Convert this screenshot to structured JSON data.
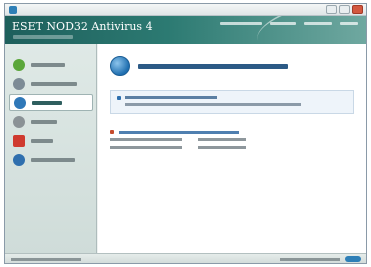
{
  "window": {
    "title": "",
    "app_name": "ESET NOD32 Antivirus 4",
    "tagline": ""
  },
  "colors": {
    "brand": "#2c7a72",
    "sidebar": "#dfe9e6",
    "accent_blue": "#1f6fb0",
    "warning": "#c64b2c"
  },
  "header_menu": [
    {
      "label": ""
    },
    {
      "label": ""
    },
    {
      "label": ""
    },
    {
      "label": ""
    }
  ],
  "sidebar": {
    "items": [
      {
        "label": "",
        "icon": "shield-check-icon",
        "color": "#5aa63a"
      },
      {
        "label": "",
        "icon": "magnifier-icon",
        "color": "#7d8b96"
      },
      {
        "label": "",
        "icon": "globe-icon",
        "color": "#2f78b8",
        "active": true
      },
      {
        "label": "",
        "icon": "gear-icon",
        "color": "#8a9296"
      },
      {
        "label": "",
        "icon": "toolbox-icon",
        "color": "#cf3a2f"
      },
      {
        "label": "",
        "icon": "help-icon",
        "color": "#2f6fae"
      }
    ]
  },
  "main": {
    "headline": "",
    "status_icon": "info-globe-icon",
    "notice": {
      "line1": "",
      "line2": ""
    },
    "details_heading": "",
    "details": [
      {
        "key": "",
        "value": ""
      },
      {
        "key": "",
        "value": ""
      }
    ]
  },
  "statusbar": {
    "left": "",
    "right": ""
  }
}
